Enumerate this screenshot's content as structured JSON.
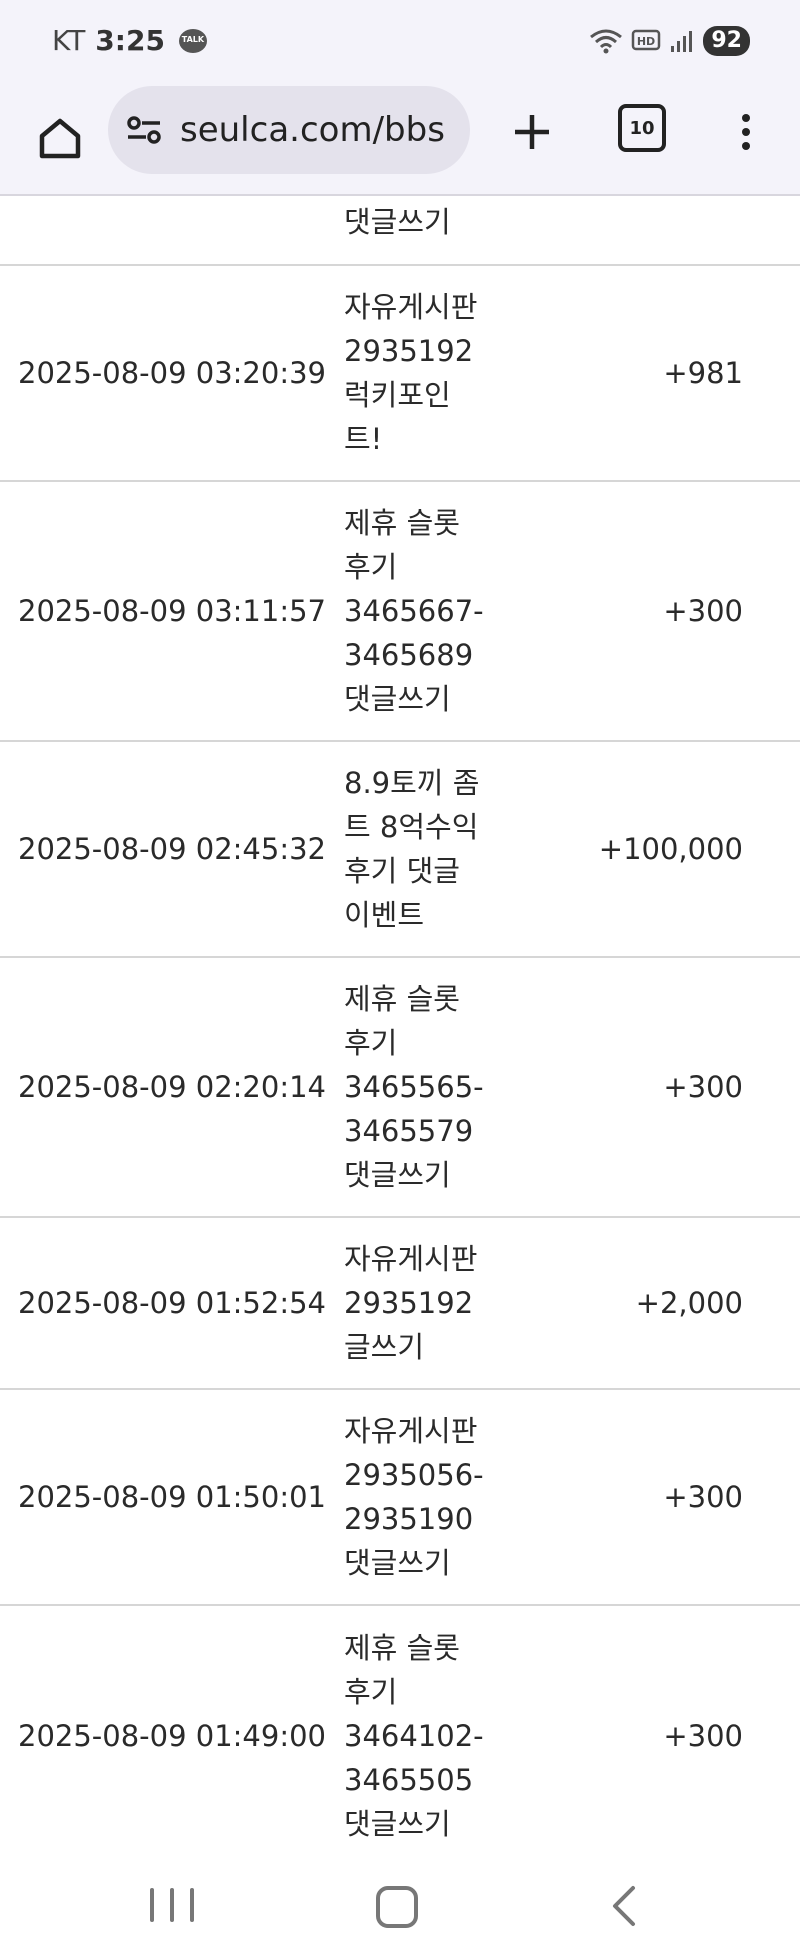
{
  "status_bar": {
    "carrier": "KT",
    "time": "3:25",
    "talk_badge": "TALK",
    "hd_label": "HD",
    "battery": "92"
  },
  "browser": {
    "url": "seulca.com/bbs",
    "tab_count": "10"
  },
  "rows": [
    {
      "date": "",
      "desc": "댓글쓰기",
      "amount": ""
    },
    {
      "date": "2025-08-09 03:20:39",
      "desc": "자유게시판\n2935192\n럭키포인\n트!",
      "amount": "+981"
    },
    {
      "date": "2025-08-09 03:11:57",
      "desc": "제휴 슬롯\n후기\n3465667-\n3465689\n댓글쓰기",
      "amount": "+300"
    },
    {
      "date": "2025-08-09 02:45:32",
      "desc": "8.9토끼 좀\n트 8억수익\n후기 댓글\n이벤트",
      "amount": "+100,000"
    },
    {
      "date": "2025-08-09 02:20:14",
      "desc": "제휴 슬롯\n후기\n3465565-\n3465579\n댓글쓰기",
      "amount": "+300"
    },
    {
      "date": "2025-08-09 01:52:54",
      "desc": "자유게시판\n2935192\n글쓰기",
      "amount": "+2,000"
    },
    {
      "date": "2025-08-09 01:50:01",
      "desc": "자유게시판\n2935056-\n2935190\n댓글쓰기",
      "amount": "+300"
    },
    {
      "date": "2025-08-09 01:49:00",
      "desc": "제휴 슬롯\n후기\n3464102-\n3465505\n댓글쓰기",
      "amount": "+300"
    }
  ]
}
